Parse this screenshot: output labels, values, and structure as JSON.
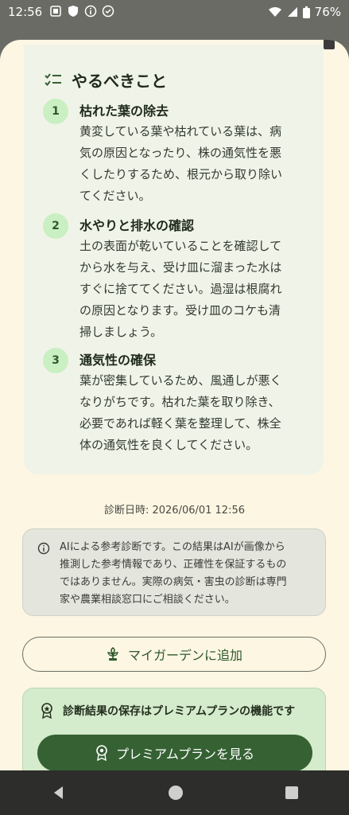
{
  "status_bar": {
    "time": "12:56",
    "battery": "76%"
  },
  "todo": {
    "title": "やるべきこと",
    "items": [
      {
        "number": "1",
        "title": "枯れた葉の除去",
        "lines": [
          "黄変している葉や枯れている葉は、病",
          "気の原因となったり、株の通気性を悪",
          "くしたりするため、根元から取り除い",
          "てください。"
        ]
      },
      {
        "number": "2",
        "title": "水やりと排水の確認",
        "lines": [
          "土の表面が乾いていることを確認して",
          "から水を与え、受け皿に溜まった水は",
          "すぐに捨ててください。過湿は根腐れ",
          "の原因となります。受け皿のコケも清",
          "掃しましょう。"
        ]
      },
      {
        "number": "3",
        "title": "通気性の確保",
        "lines": [
          "葉が密集しているため、風通しが悪く",
          "なりがちです。枯れた葉を取り除き、",
          "必要であれば軽く葉を整理して、株全",
          "体の通気性を良くしてください。"
        ]
      }
    ]
  },
  "diagnosis_time": "診断日時: 2026/06/01 12:56",
  "notice": {
    "lines": [
      "AIによる参考診断です。この結果はAIが画像から",
      "推測した参考情報であり、正確性を保証するもの",
      "ではありません。実際の病気・害虫の診断は専門",
      "家や農業相談窓口にご相談ください。"
    ]
  },
  "garden_button": "マイガーデンに追加",
  "premium": {
    "message": "診断結果の保存はプレミアムプランの機能です",
    "button": "プレミアムプランを見る"
  },
  "colors": {
    "accent": "#356133",
    "sheet_bg": "#fcf6e3",
    "card_bg": "#f0f3e8",
    "step_circle": "#c9efc2"
  }
}
